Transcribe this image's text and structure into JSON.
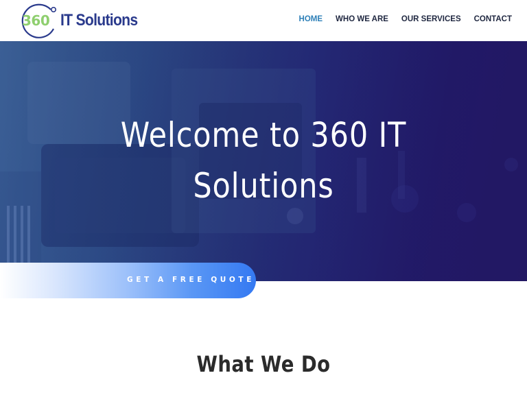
{
  "logo": {
    "mark_text": "360",
    "name": "IT Solutions",
    "mark_icon": "circular-arrow-icon"
  },
  "nav": {
    "items": [
      {
        "label": "HOME",
        "active": true
      },
      {
        "label": "WHO WE ARE",
        "active": false
      },
      {
        "label": "OUR SERVICES",
        "active": false
      },
      {
        "label": "CONTACT",
        "active": false
      }
    ]
  },
  "hero": {
    "title_line1": "Welcome to 360 IT",
    "title_line2": "Solutions"
  },
  "cta": {
    "label": "GET A FREE QUOTE"
  },
  "section": {
    "heading": "What We Do"
  },
  "colors": {
    "brand_navy": "#2a3a8c",
    "logo_green": "#8fcf6f",
    "nav_active": "#2e80b8",
    "nav_text": "#1f2740",
    "cta_blue": "#3479f2"
  }
}
